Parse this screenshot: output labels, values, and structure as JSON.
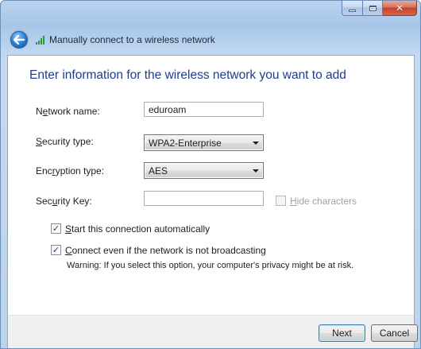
{
  "window": {
    "nav_title": "Manually connect to a wireless network"
  },
  "main": {
    "heading": "Enter information for the wireless network you want to add",
    "network_name": {
      "label_pre": "N",
      "label_u": "e",
      "label_post": "twork name:",
      "value": "eduroam"
    },
    "security_type": {
      "label_pre": "",
      "label_u": "S",
      "label_post": "ecurity type:",
      "value": "WPA2-Enterprise"
    },
    "encryption_type": {
      "label_pre": "Enc",
      "label_u": "r",
      "label_post": "yption type:",
      "value": "AES"
    },
    "security_key": {
      "label_pre": "Sec",
      "label_u": "u",
      "label_post": "rity Key:",
      "value": ""
    },
    "hide_characters": {
      "label_pre": "",
      "label_u": "H",
      "label_post": "ide characters",
      "checked": false,
      "enabled": false
    },
    "start_auto": {
      "label_pre": "",
      "label_u": "S",
      "label_post": "tart this connection automatically",
      "checked": true
    },
    "connect_even": {
      "label_pre": "",
      "label_u": "C",
      "label_post": "onnect even if the network is not broadcasting",
      "checked": true
    },
    "warning": "Warning: If you select this option, your computer's privacy might be at risk."
  },
  "footer": {
    "next_label": "Next",
    "cancel_label": "Cancel"
  },
  "colors": {
    "heading": "#1d3d8f",
    "frame": "#a7c6e8",
    "close_button": "#c4422a"
  }
}
